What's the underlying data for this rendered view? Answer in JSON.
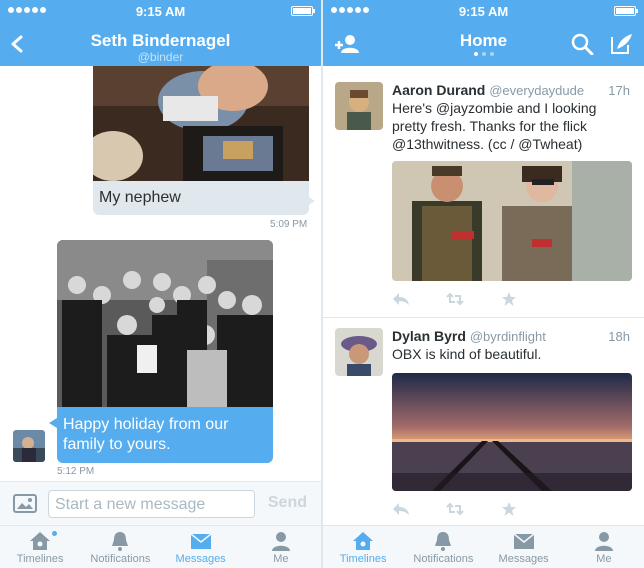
{
  "status": {
    "time_left": "9:15 AM",
    "time_right": "9:15 AM"
  },
  "dm": {
    "title": "Seth Bindernagel",
    "handle": "@binder",
    "msg1_text": "My nephew",
    "msg1_time": "5:09 PM",
    "msg2_text": "Happy holiday from our family to yours.",
    "msg2_time": "5:12 PM",
    "composer_placeholder": "Start a new message",
    "send_label": "Send"
  },
  "home": {
    "title": "Home"
  },
  "tabs": [
    {
      "label": "Timelines"
    },
    {
      "label": "Notifications"
    },
    {
      "label": "Messages"
    },
    {
      "label": "Me"
    }
  ],
  "tweets": [
    {
      "name": "Aaron Durand",
      "handle": "@everydaydude",
      "time": "17h",
      "text": "Here's @jayzombie and I looking pretty fresh. Thanks for the flick @13thwitness.  (cc / @Twheat)"
    },
    {
      "name": "Dylan Byrd",
      "handle": "@byrdinflight",
      "time": "18h",
      "text": "OBX is kind of beautiful."
    }
  ],
  "colors": {
    "brand": "#55acee",
    "gray_text": "#8899a6",
    "bubble_gray": "#e1e8ed"
  },
  "icons": [
    "back-arrow-icon",
    "add-user-icon",
    "search-icon",
    "compose-icon",
    "image-icon",
    "home-icon",
    "bell-icon",
    "envelope-icon",
    "person-icon",
    "reply-icon",
    "retweet-icon",
    "favorite-icon"
  ]
}
